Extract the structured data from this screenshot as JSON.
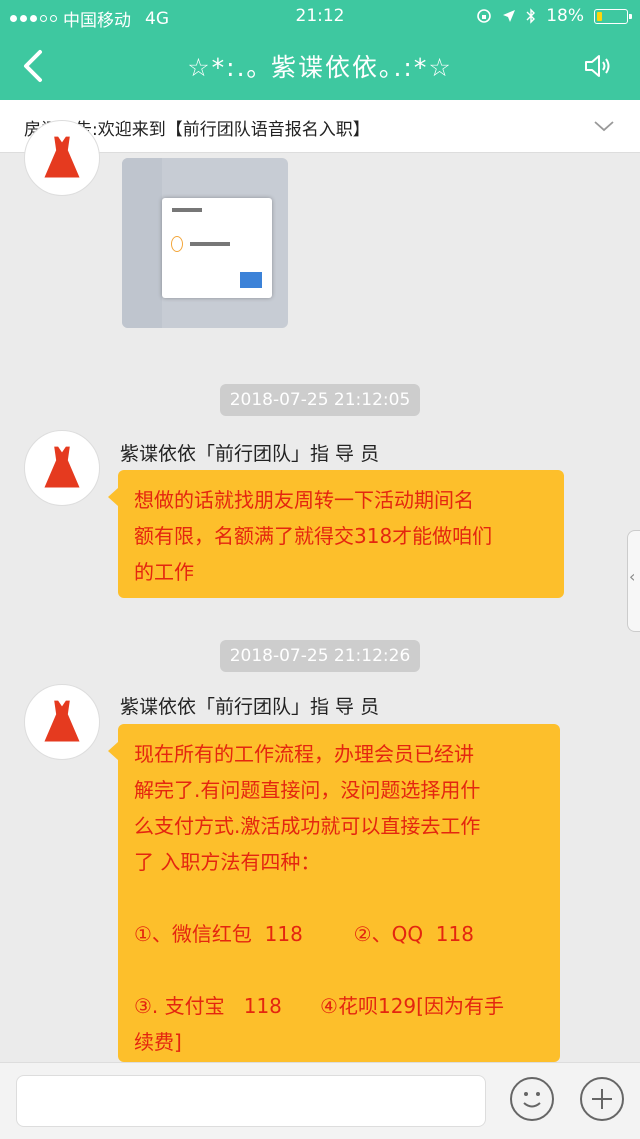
{
  "status": {
    "carrier": "中国移动",
    "network": "4G",
    "time": "21:12",
    "battery": "18%"
  },
  "nav": {
    "title": "☆*:.｡ 紫谍依依｡.:*☆",
    "back_icon": "chevron-left-icon",
    "speaker_icon": "speaker-icon"
  },
  "notice": {
    "text": "房间公告:欢迎来到【前行团队语音报名入职】",
    "expand_icon": "chevron-down-icon"
  },
  "messages": [
    {
      "timestamp": "2018-07-25 21:12:05",
      "sender": "紫谍依依「前行团队」指 导 员",
      "text": "想做的话就找朋友周转一下活动期间名\n额有限，名额满了就得交318才能做咱们\n的工作"
    },
    {
      "timestamp": "2018-07-25 21:12:26",
      "sender": "紫谍依依「前行团队」指 导 员",
      "text": "现在所有的工作流程，办理会员已经讲\n解完了.有问题直接问，没问题选择用什\n么支付方式.激活成功就可以直接去工作\n了 入职方法有四种：\n\n①、微信红包  118        ②、QQ  118\n\n③. 支付宝   118      ④花呗129[因为有手\n续费]"
    }
  ],
  "colors": {
    "header": "#3ec8a0",
    "bubble": "#fdbf2b",
    "bubble_text": "#e4260f",
    "avatar_dress": "#e53a1f"
  }
}
